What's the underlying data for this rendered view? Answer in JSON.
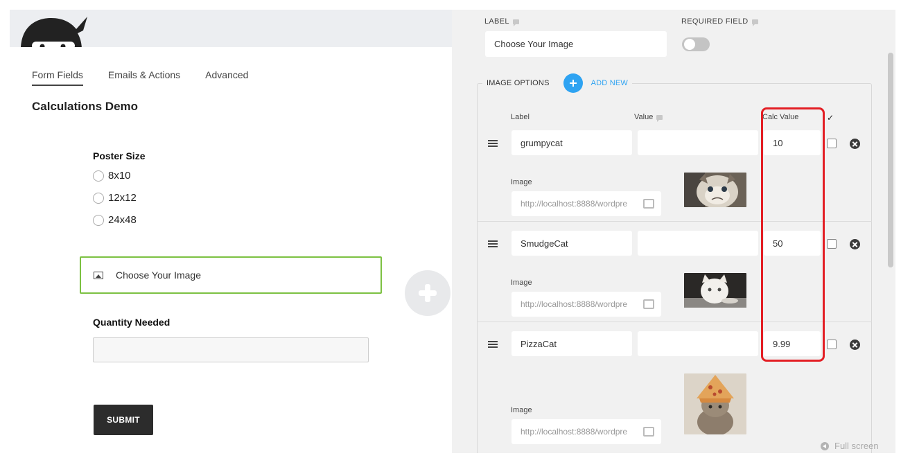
{
  "builder": {
    "tabs": [
      {
        "label": "Form Fields",
        "active": true
      },
      {
        "label": "Emails & Actions",
        "active": false
      },
      {
        "label": "Advanced",
        "active": false
      }
    ],
    "form_title": "Calculations Demo",
    "fields": {
      "poster_size": {
        "label": "Poster Size",
        "options": [
          "8x10",
          "12x12",
          "24x48"
        ]
      },
      "image_field": {
        "label": "Choose Your Image",
        "icon": "image-icon"
      },
      "quantity": {
        "label": "Quantity Needed",
        "value": ""
      },
      "submit": {
        "label": "SUBMIT"
      }
    },
    "add_field_icon": "plus-icon"
  },
  "settings": {
    "label_header": "LABEL",
    "required_header": "REQUIRED FIELD",
    "label_value": "Choose Your Image",
    "required_on": false,
    "image_options_header": "IMAGE OPTIONS",
    "add_new_label": "ADD NEW",
    "columns": {
      "label": "Label",
      "value": "Value",
      "calc": "Calc Value",
      "selected": "✓"
    },
    "image_label": "Image",
    "options": [
      {
        "label": "grumpycat",
        "value": "",
        "calc": "10",
        "checked": false,
        "image_url": "http://localhost:8888/wordpre"
      },
      {
        "label": "SmudgeCat",
        "value": "",
        "calc": "50",
        "checked": false,
        "image_url": "http://localhost:8888/wordpre"
      },
      {
        "label": "PizzaCat",
        "value": "",
        "calc": "9.99",
        "checked": false,
        "image_url": "http://localhost:8888/wordpre"
      }
    ]
  },
  "footer": {
    "fullscreen_label": "Full screen"
  },
  "colors": {
    "accent_blue": "#2ea3f2",
    "highlight_red": "#e31e24",
    "selected_green": "#7cc142"
  }
}
